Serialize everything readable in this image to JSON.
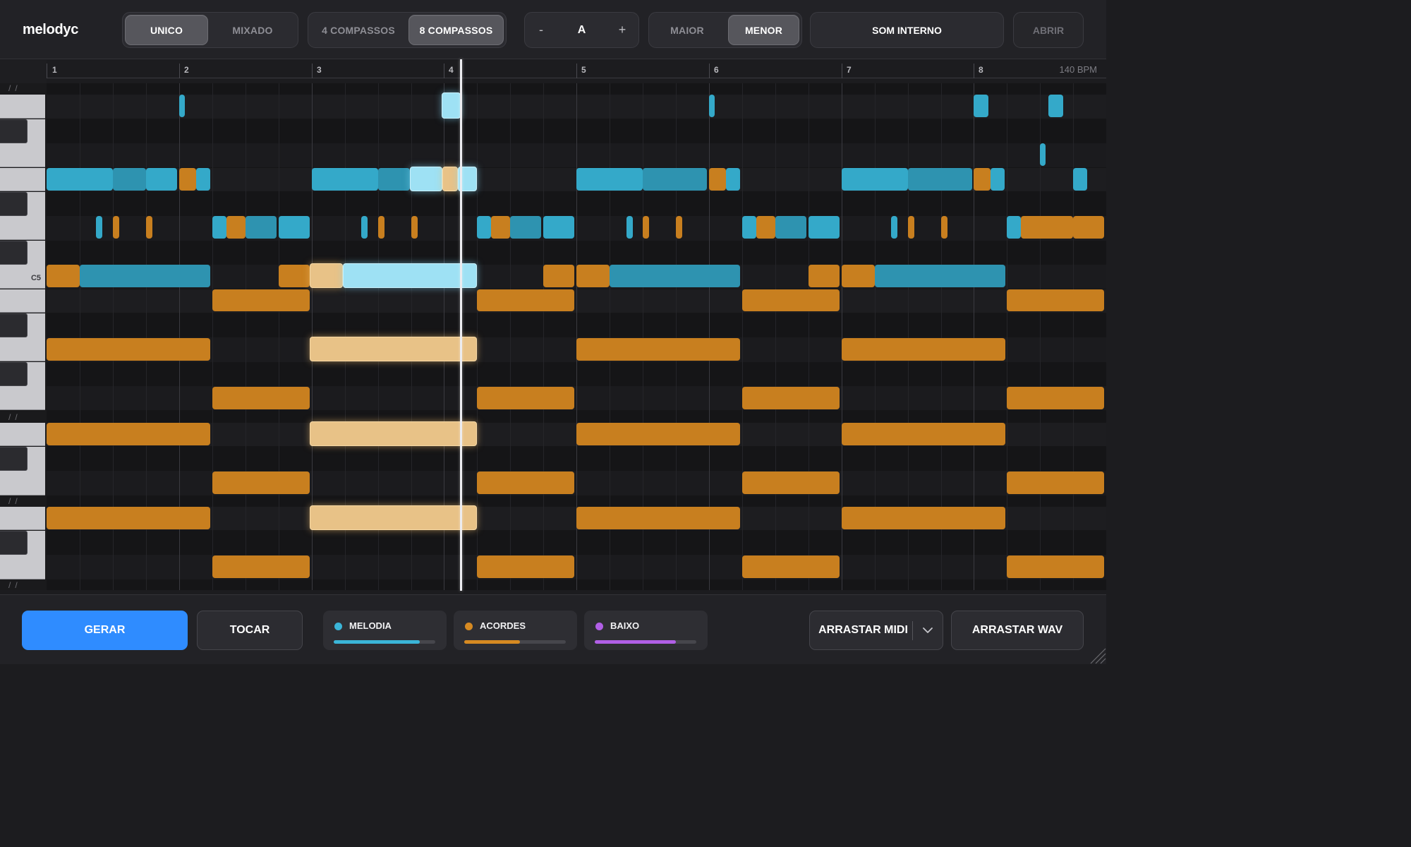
{
  "app": {
    "title": "melodyc"
  },
  "toolbar": {
    "mode": {
      "options": [
        "UNICO",
        "MIXADO"
      ],
      "selected": "UNICO"
    },
    "length": {
      "options": [
        "4 COMPASSOS",
        "8 COMPASSOS"
      ],
      "selected": "8 COMPASSOS"
    },
    "key": {
      "minus": "-",
      "value": "A",
      "plus": "+"
    },
    "scale": {
      "options": [
        "MAIOR",
        "MENOR"
      ],
      "selected": "MENOR"
    },
    "sound": "SOM INTERNO",
    "open": "ABRIR"
  },
  "ruler": {
    "bars": [
      "1",
      "2",
      "3",
      "4",
      "5",
      "6",
      "7",
      "8"
    ],
    "bpm": "140 BPM"
  },
  "piano": {
    "label": "C5",
    "slashes": "//"
  },
  "tracks": [
    {
      "name": "MELODIA",
      "color": "#3bb5d8",
      "volume": 0.85
    },
    {
      "name": "ACORDES",
      "color": "#d68a22",
      "volume": 0.55
    },
    {
      "name": "BAIXO",
      "color": "#b15fe6",
      "volume": 0.8
    }
  ],
  "bottom": {
    "generate": "GERAR",
    "play": "TOCAR",
    "drag_midi": "ARRASTAR MIDI",
    "drag_wav": "ARRASTAR WAV"
  },
  "icons": {
    "midi_menu": "chevron-down-icon",
    "resize": "resize-grip-icon"
  },
  "colors": {
    "accent": "#2f8cff",
    "melody": "#34a9c9",
    "chords": "#c87f1f",
    "bass": "#b15fe6"
  }
}
